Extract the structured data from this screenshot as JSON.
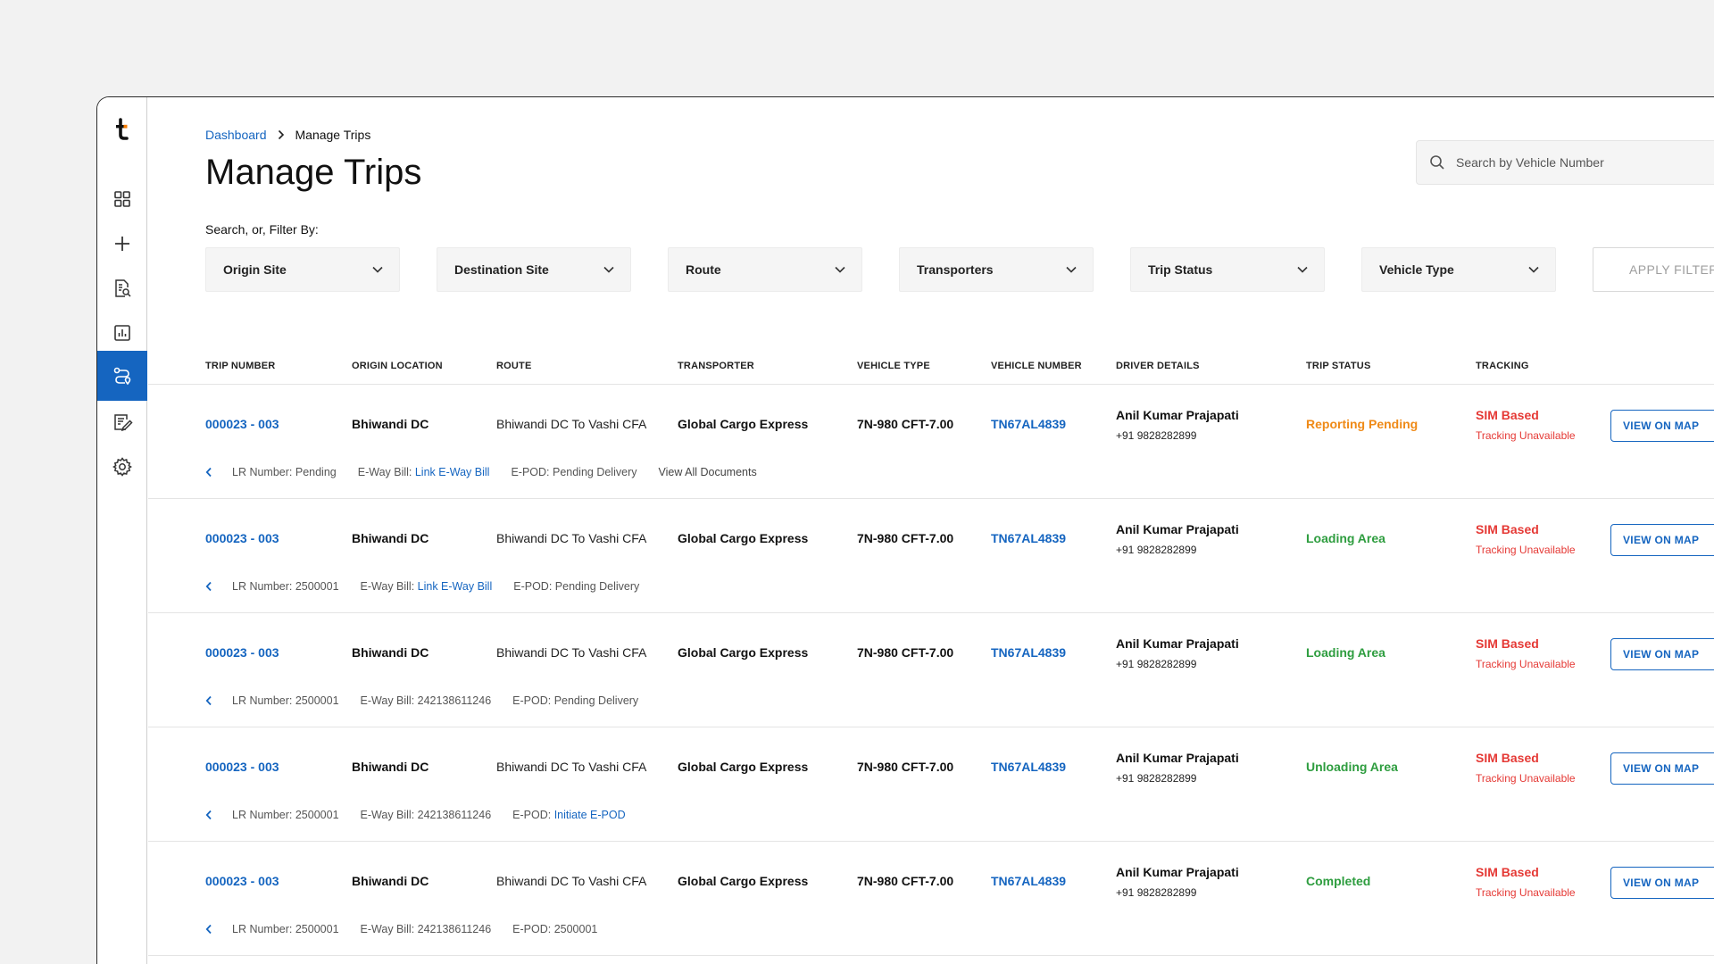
{
  "colors": {
    "primary": "#1565c0",
    "status_pending": "#ef8a17",
    "status_ok": "#2e9d3f",
    "danger": "#e53935"
  },
  "sidebar": {
    "logo_letter": "t",
    "items": [
      {
        "name": "dashboard-grid-icon"
      },
      {
        "name": "add-icon"
      },
      {
        "name": "document-search-icon"
      },
      {
        "name": "analytics-chart-icon"
      },
      {
        "name": "route-icon",
        "active": true
      },
      {
        "name": "edit-document-icon"
      },
      {
        "name": "settings-gear-icon"
      }
    ]
  },
  "breadcrumb": {
    "home": "Dashboard",
    "current": "Manage Trips"
  },
  "page_title": "Manage Trips",
  "search": {
    "placeholder": "Search by Vehicle Number"
  },
  "filters": {
    "label": "Search, or, Filter By:",
    "dropdowns": [
      "Origin Site",
      "Destination Site",
      "Route",
      "Transporters",
      "Trip Status",
      "Vehicle Type"
    ],
    "apply_label": "APPLY FILTERS"
  },
  "table": {
    "headers": {
      "trip": "TRIP NUMBER",
      "origin": "ORIGIN LOCATION",
      "route": "ROUTE",
      "transporter": "TRANSPORTER",
      "vtype": "VEHICLE TYPE",
      "vnum": "VEHICLE NUMBER",
      "driver": "DRIVER DETAILS",
      "status": "TRIP STATUS",
      "tracking": "TRACKING"
    },
    "action_label": "VIEW ON MAP",
    "rows": [
      {
        "trip": "000023 - 003",
        "origin": "Bhiwandi DC",
        "route": "Bhiwandi DC To Vashi CFA",
        "transporter": "Global Cargo Express",
        "vtype": "7N-980 CFT-7.00",
        "vnum": "TN67AL4839",
        "driver_name": "Anil Kumar Prajapati",
        "driver_phone": "+91 9828282899",
        "status": "Reporting Pending",
        "status_color": "#ef8a17",
        "track_type": "SIM Based",
        "track_note": "Tracking Unavailable",
        "lr": "LR Number: Pending",
        "eway_label": "E-Way Bill: ",
        "eway_value": "",
        "eway_link": "Link E-Way Bill",
        "epod_label": "E-POD: Pending Delivery",
        "epod_link": "",
        "view_all": "View All Documents"
      },
      {
        "trip": "000023 - 003",
        "origin": "Bhiwandi DC",
        "route": "Bhiwandi DC To Vashi CFA",
        "transporter": "Global Cargo Express",
        "vtype": "7N-980 CFT-7.00",
        "vnum": "TN67AL4839",
        "driver_name": "Anil Kumar Prajapati",
        "driver_phone": "+91 9828282899",
        "status": "Loading Area",
        "status_color": "#2e9d3f",
        "track_type": "SIM Based",
        "track_note": "Tracking Unavailable",
        "lr": "LR Number: 2500001",
        "eway_label": "E-Way Bill: ",
        "eway_value": "",
        "eway_link": "Link E-Way Bill",
        "epod_label": "E-POD: Pending Delivery",
        "epod_link": "",
        "view_all": ""
      },
      {
        "trip": "000023 - 003",
        "origin": "Bhiwandi DC",
        "route": "Bhiwandi DC To Vashi CFA",
        "transporter": "Global Cargo Express",
        "vtype": "7N-980 CFT-7.00",
        "vnum": "TN67AL4839",
        "driver_name": "Anil Kumar Prajapati",
        "driver_phone": "+91 9828282899",
        "status": "Loading Area",
        "status_color": "#2e9d3f",
        "track_type": "SIM Based",
        "track_note": "Tracking Unavailable",
        "lr": "LR Number: 2500001",
        "eway_label": "E-Way Bill: ",
        "eway_value": "242138611246",
        "eway_link": "",
        "epod_label": "E-POD: Pending Delivery",
        "epod_link": "",
        "view_all": ""
      },
      {
        "trip": "000023 - 003",
        "origin": "Bhiwandi DC",
        "route": "Bhiwandi DC To Vashi CFA",
        "transporter": "Global Cargo Express",
        "vtype": "7N-980 CFT-7.00",
        "vnum": "TN67AL4839",
        "driver_name": "Anil Kumar Prajapati",
        "driver_phone": "+91 9828282899",
        "status": "Unloading Area",
        "status_color": "#2e9d3f",
        "track_type": "SIM Based",
        "track_note": "Tracking Unavailable",
        "lr": "LR Number: 2500001",
        "eway_label": "E-Way Bill: ",
        "eway_value": "242138611246",
        "eway_link": "",
        "epod_label": "E-POD: ",
        "epod_link": "Initiate E-POD",
        "view_all": ""
      },
      {
        "trip": "000023 - 003",
        "origin": "Bhiwandi DC",
        "route": "Bhiwandi DC To Vashi CFA",
        "transporter": "Global Cargo Express",
        "vtype": "7N-980 CFT-7.00",
        "vnum": "TN67AL4839",
        "driver_name": "Anil Kumar Prajapati",
        "driver_phone": "+91 9828282899",
        "status": "Completed",
        "status_color": "#2e9d3f",
        "track_type": "SIM Based",
        "track_note": "Tracking Unavailable",
        "lr": "LR Number: 2500001",
        "eway_label": "E-Way Bill: ",
        "eway_value": "242138611246",
        "eway_link": "",
        "epod_label": "E-POD: 2500001",
        "epod_link": "",
        "view_all": ""
      }
    ]
  }
}
